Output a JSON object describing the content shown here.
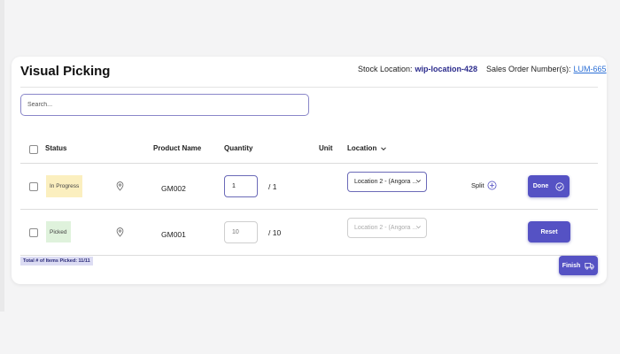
{
  "header": {
    "title": "Visual Picking",
    "stock_location_label": "Stock Location:",
    "stock_location_value": "wip-location-428",
    "sales_order_label": "Sales Order Number(s):",
    "sales_order_value": "LUM-665"
  },
  "search": {
    "placeholder": "Search..."
  },
  "table": {
    "columns": {
      "status": "Status",
      "product_name": "Product Name",
      "quantity": "Quantity",
      "unit": "Unit",
      "location": "Location"
    },
    "rows": [
      {
        "status": "In Progress",
        "product": "GM002",
        "qty_value": "1",
        "qty_total": "/ 1",
        "location": "Location 2 - (Angora ...",
        "split_label": "Split",
        "action": "Done"
      },
      {
        "status": "Picked",
        "product": "GM001",
        "qty_placeholder": "10",
        "qty_total": "/ 10",
        "location": "Location 2 - (Angora ...",
        "action": "Reset"
      }
    ]
  },
  "footer": {
    "total_picked": "Total # of Items Picked: 11/11",
    "finish_label": "Finish"
  },
  "colors": {
    "accent": "#5552c4",
    "in_progress": "#fbefbf",
    "picked": "#dff2dc",
    "link": "#2b6fd6"
  },
  "icons": [
    "location-pin-icon",
    "chevron-down-icon",
    "plus-circle-icon",
    "check-circle-icon",
    "truck-icon"
  ]
}
